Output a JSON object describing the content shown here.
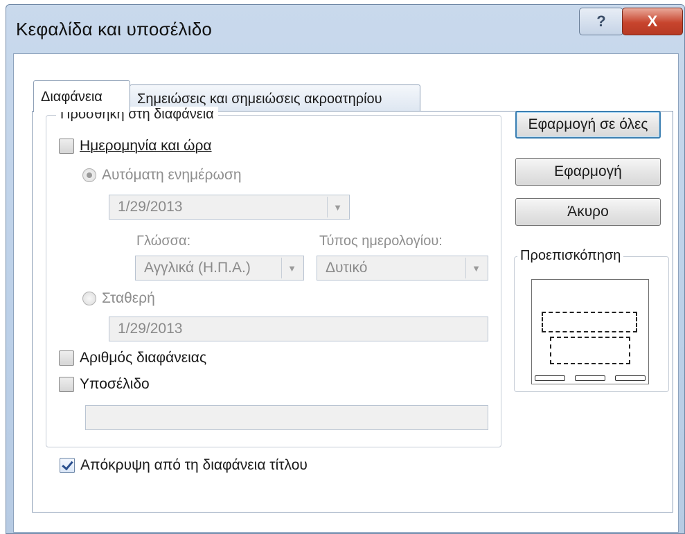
{
  "window": {
    "title": "Κεφαλίδα και υποσέλιδο",
    "help_glyph": "?",
    "close_glyph": "X"
  },
  "tabs": [
    {
      "label": "Διαφάνεια",
      "active": true
    },
    {
      "label": "Σημειώσεις και σημειώσεις ακροατηρίου",
      "active": false
    }
  ],
  "slide_tab": {
    "group_label": "Προσθήκη στη διαφάνεια",
    "date_time": {
      "label": "Ημερομηνία και ώρα",
      "checked": false
    },
    "auto_update": {
      "label": "Αυτόματη ενημέρωση",
      "selected": true,
      "value": "1/29/2013"
    },
    "language": {
      "label": "Γλώσσα:",
      "value": "Αγγλικά (Η.Π.Α.)"
    },
    "calendar_type": {
      "label": "Τύπος ημερολογίου:",
      "value": "Δυτικό"
    },
    "fixed": {
      "label": "Σταθερή",
      "selected": false,
      "value": "1/29/2013"
    },
    "slide_number": {
      "label": "Αριθμός διαφάνειας",
      "checked": false
    },
    "footer": {
      "label": "Υποσέλιδο",
      "checked": false,
      "value": ""
    },
    "dont_show_on_title": {
      "label": "Απόκρυψη από τη διαφάνεια τίτλου",
      "checked": true
    }
  },
  "buttons": {
    "apply_all": "Εφαρμογή σε όλες",
    "apply": "Εφαρμογή",
    "cancel": "Άκυρο"
  },
  "preview": {
    "label": "Προεπισκόπηση"
  },
  "icons": {
    "dropdown": "chevron-down-icon"
  }
}
